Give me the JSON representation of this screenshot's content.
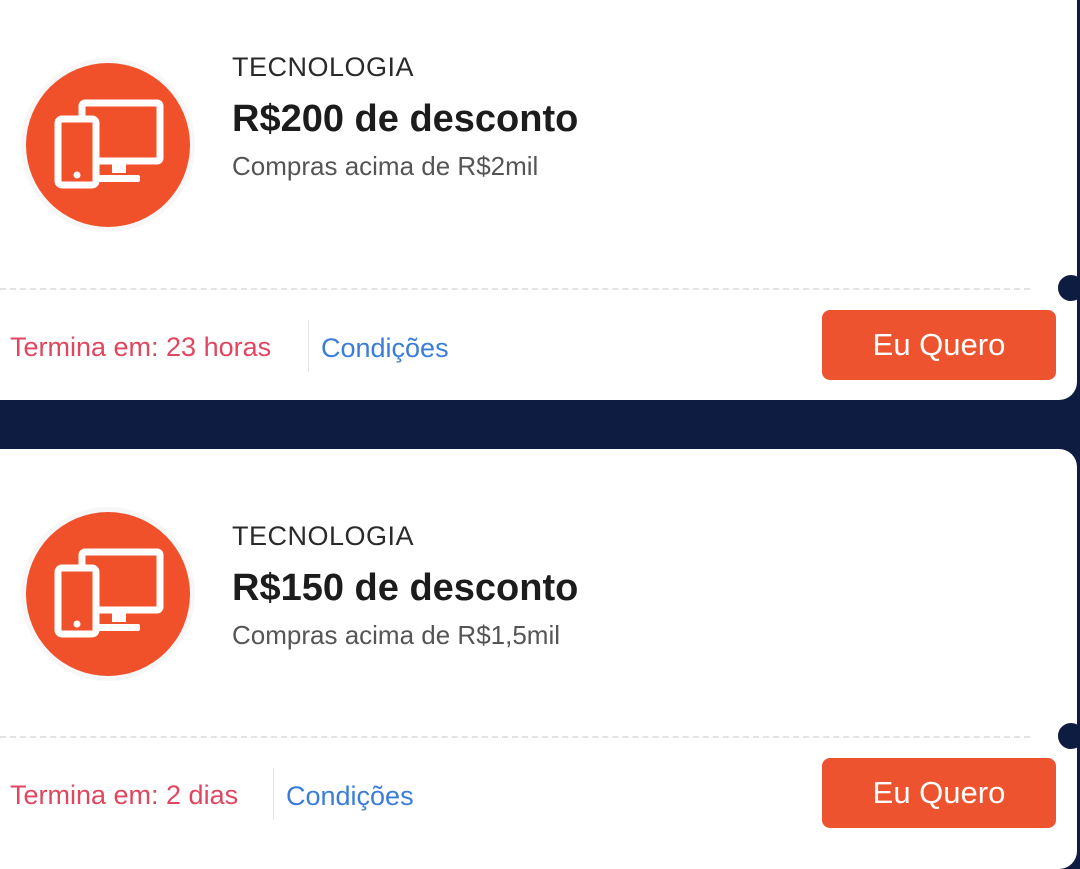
{
  "coupons": [
    {
      "category": "TECNOLOGIA",
      "title": "R$200 de desconto",
      "subtitle": "Compras acima de R$2mil",
      "expires": "Termina em: 23 horas",
      "conditions_label": "Condições",
      "cta_label": "Eu Quero",
      "icon": "devices-icon"
    },
    {
      "category": "TECNOLOGIA",
      "title": "R$150 de desconto",
      "subtitle": "Compras acima de R$1,5mil",
      "expires": "Termina em: 2 dias",
      "conditions_label": "Condições",
      "cta_label": "Eu Quero",
      "icon": "devices-icon"
    }
  ],
  "colors": {
    "background": "#0e1c42",
    "accent": "#ee5330",
    "expiry_text": "#e0465f",
    "link": "#3b7dd8"
  }
}
